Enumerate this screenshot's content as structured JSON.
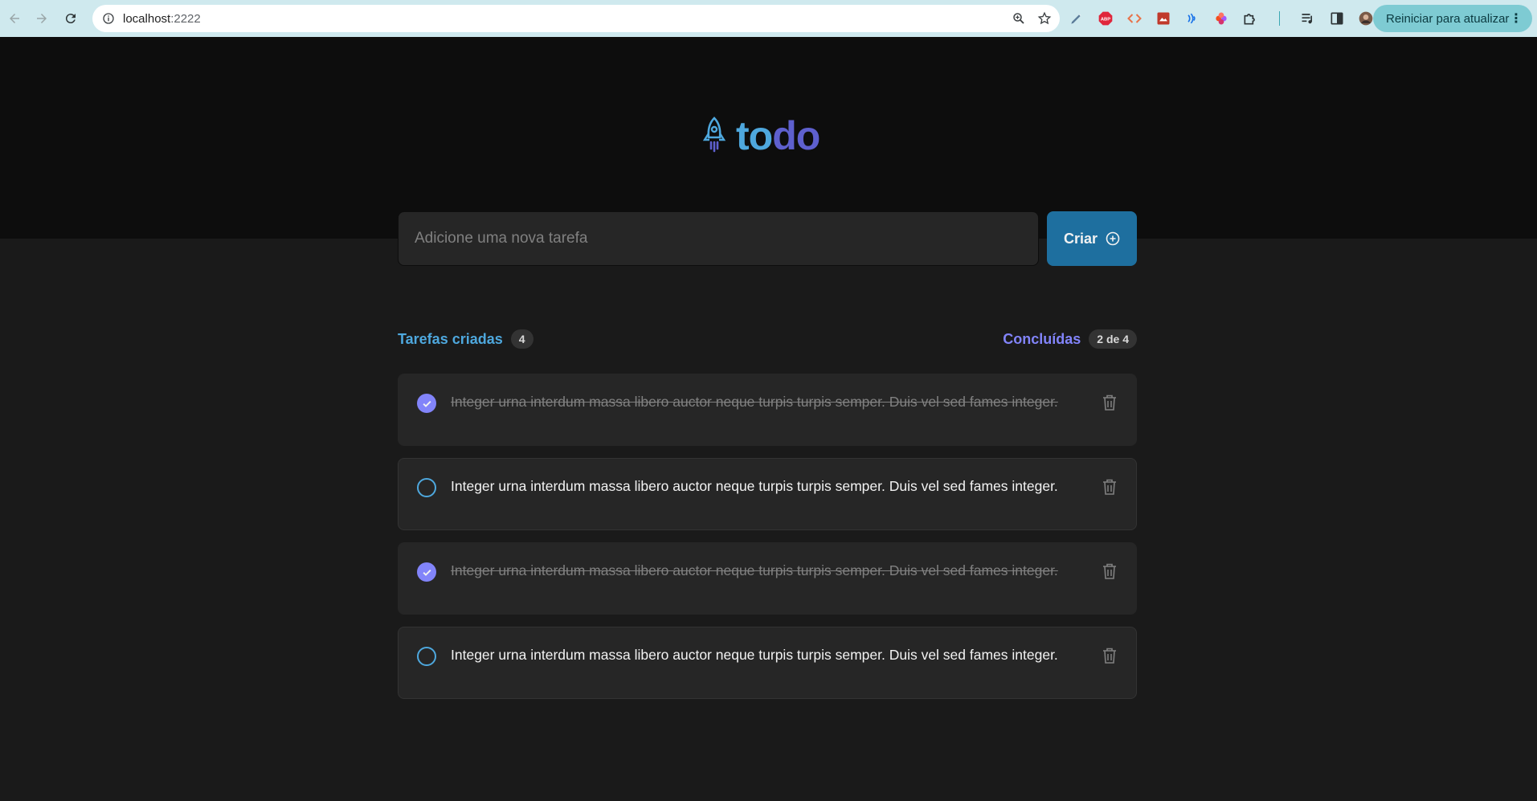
{
  "browser": {
    "url_host": "localhost",
    "url_port": ":2222",
    "update_label": "Reiniciar para atualizar",
    "extensions": [
      "pen-icon",
      "adblock-icon",
      "code-icon",
      "image-ext-icon",
      "wave-icon",
      "figma-icon",
      "puzzle-icon",
      "media-icon",
      "sidepanel-icon",
      "profile-icon"
    ]
  },
  "app": {
    "logo_part1": "to",
    "logo_part2": "do",
    "input_placeholder": "Adicione uma nova tarefa",
    "create_label": "Criar",
    "created_label": "Tarefas criadas",
    "created_count": "4",
    "done_label": "Concluídas",
    "done_count": "2 de 4",
    "colors": {
      "blue": "#4ea8de",
      "purple": "#8284fa",
      "button": "#1e6f9f"
    }
  },
  "tasks": [
    {
      "text": "Integer urna interdum massa libero auctor neque turpis turpis semper. Duis vel sed fames integer.",
      "done": true
    },
    {
      "text": "Integer urna interdum massa libero auctor neque turpis turpis semper. Duis vel sed fames integer.",
      "done": false
    },
    {
      "text": "Integer urna interdum massa libero auctor neque turpis turpis semper. Duis vel sed fames integer.",
      "done": true
    },
    {
      "text": "Integer urna interdum massa libero auctor neque turpis turpis semper. Duis vel sed fames integer.",
      "done": false
    }
  ]
}
